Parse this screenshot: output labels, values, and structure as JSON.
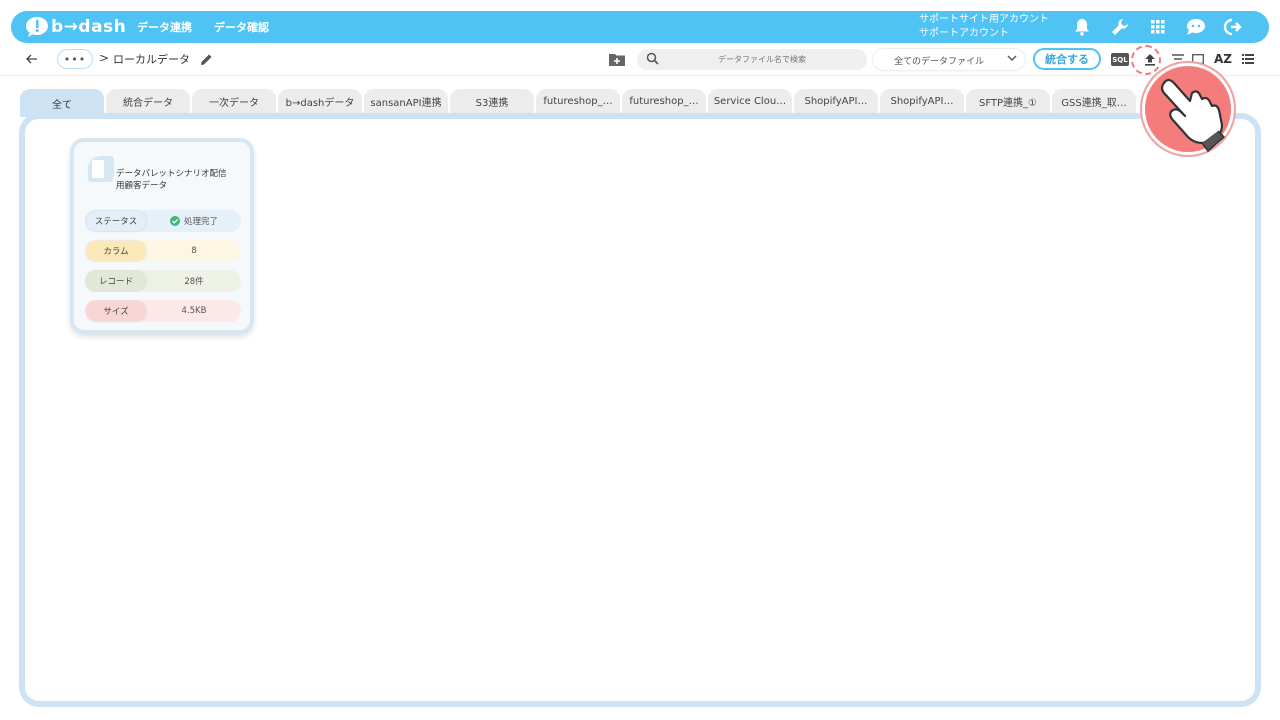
{
  "header": {
    "logo_text": "b→dash",
    "nav": [
      "データ連携",
      "データ確認"
    ],
    "account_line1": "サポートサイト用アカウント",
    "account_line2": "サポートアカウント",
    "icons": [
      "bell-icon",
      "wrench-icon",
      "apps-grid-icon",
      "chat-bot-icon",
      "logout-icon"
    ]
  },
  "toolbar": {
    "crumb_more": "•••",
    "crumb_sep": ">",
    "crumb_current": "ローカルデータ",
    "search_placeholder": "データファイル名で検索",
    "file_filter": "全てのデータファイル",
    "merge_label": "統合する",
    "sql_label": "SQL",
    "sort_label": "AZ"
  },
  "tabs": [
    "全て",
    "統合データ",
    "一次データ",
    "b→dashデータ",
    "sansanAPI連携",
    "S3連携",
    "futureshop_…",
    "futureshop_…",
    "Service Clou…",
    "ShopifyAPI…",
    "ShopifyAPI…",
    "SFTP連携_①",
    "GSS連携_取…"
  ],
  "card": {
    "title_line1": "データパレットシナリオ配信",
    "title_line2": "用顧客データ",
    "rows": [
      {
        "key": "ステータス",
        "value": "処理完了"
      },
      {
        "key": "カラム",
        "value": "8"
      },
      {
        "key": "レコード",
        "value": "28件"
      },
      {
        "key": "サイズ",
        "value": "4.5KB"
      }
    ]
  },
  "colors": {
    "header_blue": "#4fc3f4",
    "tab_active": "#cde3f3",
    "pointer_red": "#f47c7c"
  }
}
